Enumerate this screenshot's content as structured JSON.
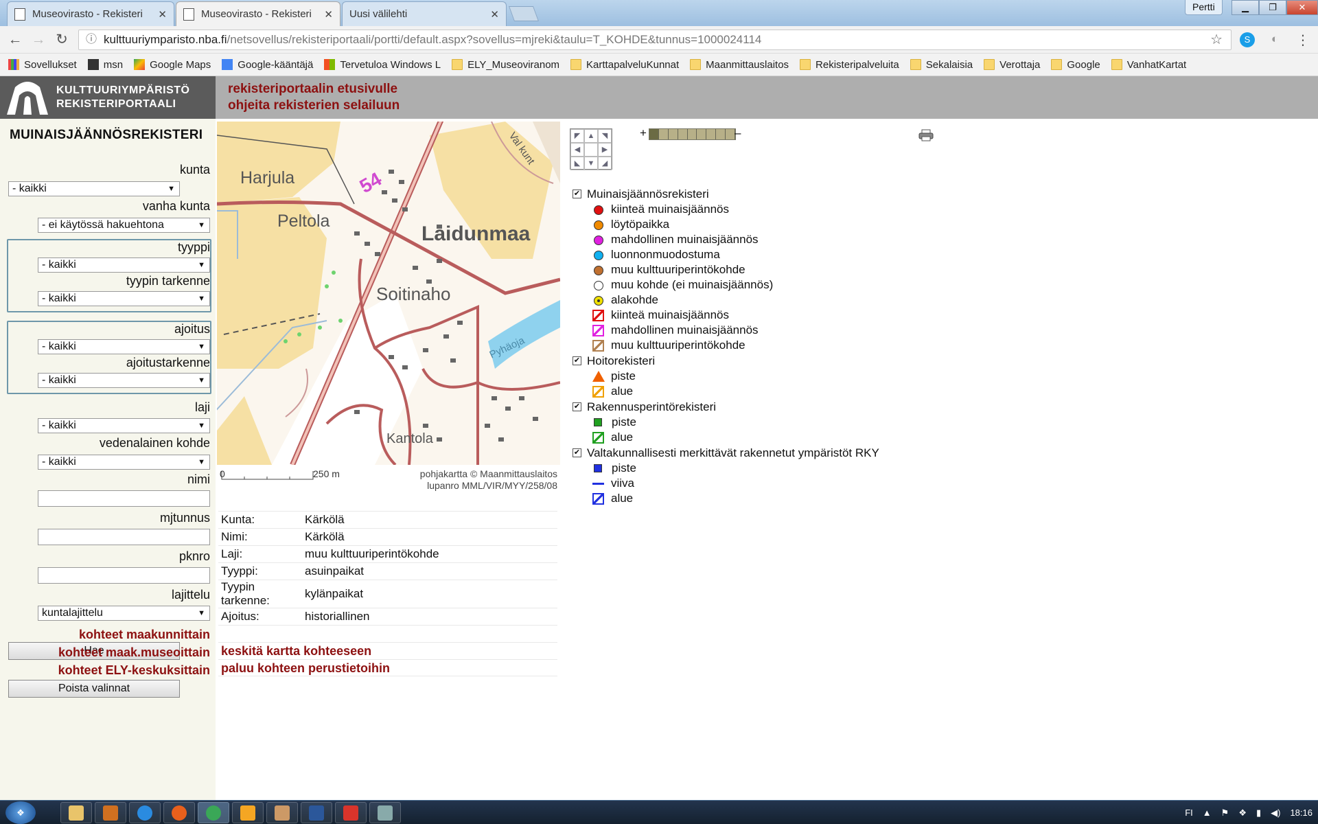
{
  "browser": {
    "tabs": [
      {
        "title": "Museovirasto - Rekisteri",
        "active": false
      },
      {
        "title": "Museovirasto - Rekisteri",
        "active": true
      },
      {
        "title": "Uusi välilehti",
        "active": false
      }
    ],
    "profile": "Pertti",
    "url_host": "kulttuuriymparisto.nba.fi",
    "url_path": "/netsovellus/rekisteriportaali/portti/default.aspx?sovellus=mjreki&taulu=T_KOHDE&tunnus=1000024114",
    "bookmarks": [
      {
        "label": "Sovellukset",
        "icon": "grid"
      },
      {
        "label": "msn",
        "icon": "msn"
      },
      {
        "label": "Google Maps",
        "icon": "maps"
      },
      {
        "label": "Google-kääntäjä",
        "icon": "gt"
      },
      {
        "label": "Tervetuloa Windows L",
        "icon": "win"
      },
      {
        "label": "ELY_Museoviranom",
        "icon": "folder"
      },
      {
        "label": "KarttapalveluKunnat",
        "icon": "folder"
      },
      {
        "label": "Maanmittauslaitos",
        "icon": "folder"
      },
      {
        "label": "Rekisteripalveluita",
        "icon": "folder"
      },
      {
        "label": "Sekalaisia",
        "icon": "folder"
      },
      {
        "label": "Verottaja",
        "icon": "folder"
      },
      {
        "label": "Google",
        "icon": "folder"
      },
      {
        "label": "VanhatKartat",
        "icon": "folder"
      }
    ]
  },
  "site": {
    "logo_line1": "KULTTUURIYMPÄRISTÖ",
    "logo_line2": "REKISTERIPORTAALI",
    "link_home": "rekisteriportaalin etusivulle",
    "link_help": "ohjeita rekisterien selailuun"
  },
  "sidebar": {
    "title": "MUINAISJÄÄNNÖSREKISTERI",
    "kunta_label": "kunta",
    "kunta_value": "- kaikki",
    "vanha_kunta_label": "vanha kunta",
    "vanha_kunta_value": "- ei käytössä hakuehtona",
    "tyyppi_label": "tyyppi",
    "tyyppi_value": "- kaikki",
    "tyypin_tarkenne_label": "tyypin tarkenne",
    "tyypin_tarkenne_value": "- kaikki",
    "ajoitus_label": "ajoitus",
    "ajoitus_value": "- kaikki",
    "ajoitustarkenne_label": "ajoitustarkenne",
    "ajoitustarkenne_value": "- kaikki",
    "laji_label": "laji",
    "laji_value": "- kaikki",
    "vedenalainen_label": "vedenalainen kohde",
    "vedenalainen_value": "- kaikki",
    "nimi_label": "nimi",
    "mjtunnus_label": "mjtunnus",
    "pknro_label": "pknro",
    "lajittelu_label": "lajittelu",
    "lajittelu_value": "kuntalajittelu",
    "search_button": "Hae",
    "clear_button": "Poista valinnat",
    "links": [
      "kohteet maakunnittain",
      "kohteet maak.museoittain",
      "kohteet ELY-keskuksittain"
    ]
  },
  "map": {
    "labels": [
      "Harjula",
      "Peltola",
      "Laidunmaa",
      "Soitinaho",
      "Kantola",
      "Pyhäoja",
      "54",
      "Val kunt"
    ],
    "scale_start": "0",
    "scale_end": "250 m",
    "copyright_line1": "pohjakartta © Maanmittauslaitos",
    "copyright_line2": "lupanro MML/VIR/MYY/258/08"
  },
  "details": {
    "rows": [
      {
        "key": "Kunta:",
        "value": "Kärkölä"
      },
      {
        "key": "Nimi:",
        "value": "Kärkölä"
      },
      {
        "key": "Laji:",
        "value": "muu kulttuuriperintökohde"
      },
      {
        "key": "Tyyppi:",
        "value": "asuinpaikat"
      },
      {
        "key": "Tyypin tarkenne:",
        "value": "kylänpaikat"
      },
      {
        "key": "Ajoitus:",
        "value": "historiallinen"
      }
    ],
    "link_center": "keskitä kartta kohteeseen",
    "link_back": "paluu kohteen perustietoihin"
  },
  "zoom": {
    "plus": "+",
    "minus": "–",
    "levels": 9,
    "current": 0
  },
  "legend": {
    "groups": [
      {
        "title": "Muinaisjäännösrekisteri",
        "items": [
          {
            "label": "kiinteä muinaisjäännös",
            "symbol": "dot",
            "color": "#e01010"
          },
          {
            "label": "löytöpaikka",
            "symbol": "dot",
            "color": "#f08a00"
          },
          {
            "label": "mahdollinen muinaisjäännös",
            "symbol": "dot",
            "color": "#e020e0"
          },
          {
            "label": "luonnonmuodostuma",
            "symbol": "dot",
            "color": "#10b0f0"
          },
          {
            "label": "muu kulttuuriperintökohde",
            "symbol": "dot",
            "color": "#c07030"
          },
          {
            "label": "muu kohde (ei muinaisjäännös)",
            "symbol": "dot",
            "color": "#ffffff"
          },
          {
            "label": "alakohde",
            "symbol": "sub",
            "color": "#f0e000"
          },
          {
            "label": "kiinteä muinaisjäännös",
            "symbol": "area",
            "color": "#e01010"
          },
          {
            "label": "mahdollinen muinaisjäännös",
            "symbol": "area",
            "color": "#e020e0"
          },
          {
            "label": "muu kulttuuriperintökohde",
            "symbol": "area",
            "color": "#b08050"
          }
        ]
      },
      {
        "title": "Hoitorekisteri",
        "items": [
          {
            "label": "piste",
            "symbol": "triangle",
            "color": "#f06000"
          },
          {
            "label": "alue",
            "symbol": "area",
            "color": "#f0a000"
          }
        ]
      },
      {
        "title": "Rakennusperintörekisteri",
        "items": [
          {
            "label": "piste",
            "symbol": "square",
            "color": "#20a020"
          },
          {
            "label": "alue",
            "symbol": "area",
            "color": "#20a020"
          }
        ]
      },
      {
        "title": "Valtakunnallisesti merkittävät rakennetut ympäristöt RKY",
        "items": [
          {
            "label": "piste",
            "symbol": "square",
            "color": "#2030e0"
          },
          {
            "label": "viiva",
            "symbol": "line",
            "color": "#2030e0"
          },
          {
            "label": "alue",
            "symbol": "area",
            "color": "#2030e0"
          }
        ]
      }
    ]
  },
  "taskbar": {
    "apps": [
      "explorer",
      "media",
      "ie",
      "firefox",
      "chrome",
      "paint",
      "notes",
      "word",
      "pdf",
      "calc"
    ],
    "language": "FI",
    "time": "18:16"
  }
}
